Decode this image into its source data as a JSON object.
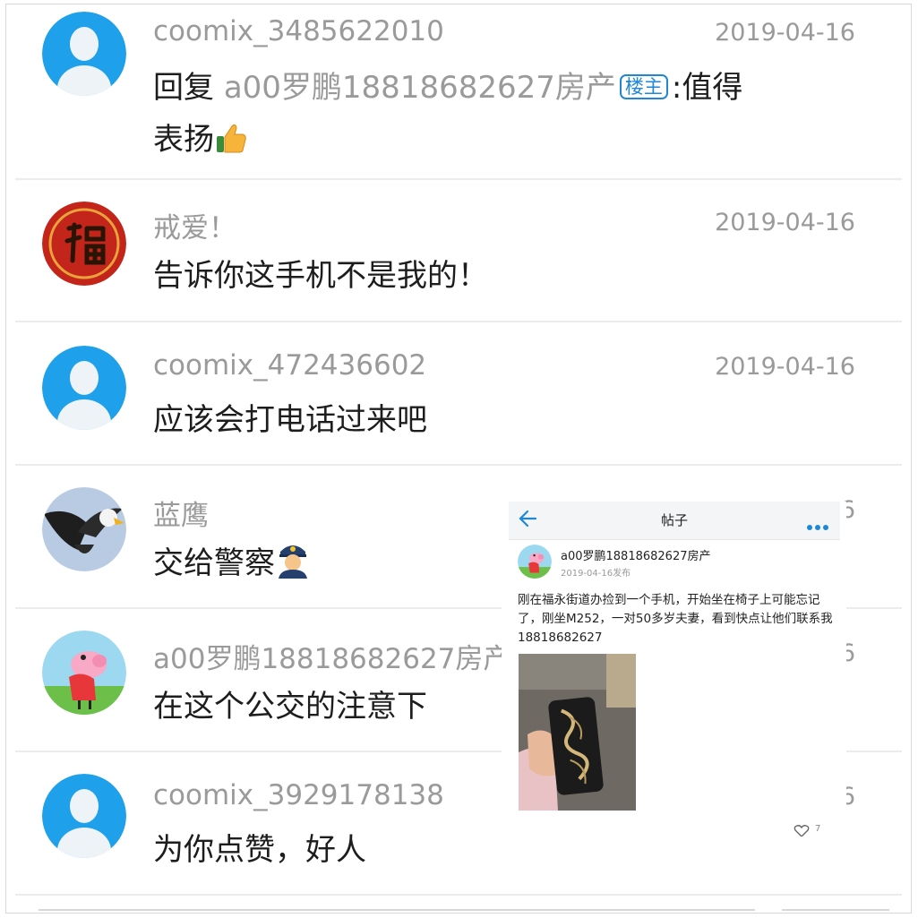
{
  "comments": [
    {
      "username": "coomix_3485622010",
      "date": "2019-04-16",
      "reply_prefix": "回复 ",
      "reply_to": "a00罗鹏18818682627房产",
      "owner_badge": "楼主",
      "text_line1_tail": ":值得",
      "text_line2": "表扬",
      "emoji": "thumbs-up-icon"
    },
    {
      "username": "戒爱！",
      "date": "2019-04-16",
      "text": "告诉你这手机不是我的！"
    },
    {
      "username": "coomix_472436602",
      "date": "2019-04-16",
      "text": "应该会打电话过来吧"
    },
    {
      "username": "蓝鹰",
      "date_partial": "6",
      "text": "交给警察",
      "emoji": "police-officer-icon"
    },
    {
      "username": "a00罗鹏18818682627房产",
      "date_partial": "6",
      "text": "在这个公交的注意下"
    },
    {
      "username": "coomix_3929178138",
      "date_partial": "6",
      "text": "为你点赞，好人"
    }
  ],
  "post": {
    "header_title": "帖子",
    "author": "a00罗鹏18818682627房产",
    "meta": "2019-04-16发布",
    "body": "刚在福永街道办捡到一个手机，开始坐在椅子上可能忘记了，刚坐M252，一对50多岁夫妻，看到快点让他们联系我18818682627",
    "like_count": "7"
  },
  "colors": {
    "accent": "#1f88d6",
    "text": "#1d1d1d",
    "muted": "#9a9a9a"
  }
}
